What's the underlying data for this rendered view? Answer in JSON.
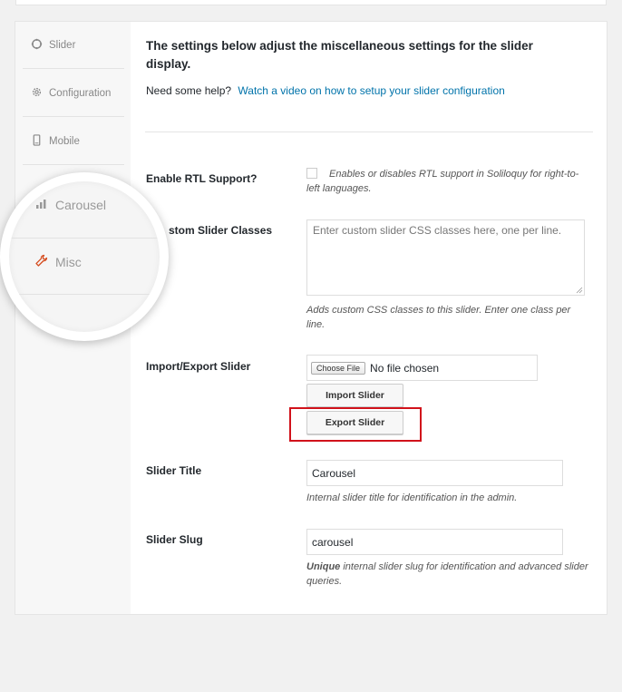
{
  "sidebar": {
    "items": [
      {
        "label": "Slider",
        "icon": "circle-icon"
      },
      {
        "label": "Configuration",
        "icon": "gear-icon"
      },
      {
        "label": "Mobile",
        "icon": "mobile-icon"
      },
      {
        "label": "Carousel",
        "icon": "chart-icon"
      },
      {
        "label": "Misc",
        "icon": "wrench-icon",
        "active": true
      }
    ]
  },
  "main": {
    "intro_title": "The settings below adjust the miscellaneous settings for the slider display.",
    "help_prefix": "Need some help?",
    "help_link": "Watch a video on how to setup your slider configuration",
    "rtl": {
      "label": "Enable RTL Support?",
      "checked": false,
      "description": "Enables or disables RTL support in Soliloquy for right-to-left languages."
    },
    "classes": {
      "label": "Custom Slider Classes",
      "label_visible": "stom Slider Classes",
      "placeholder": "Enter custom slider CSS classes here, one per line.",
      "description": "Adds custom CSS classes to this slider. Enter one class per line."
    },
    "import_export": {
      "label": "Import/Export Slider",
      "choose_file": "Choose File",
      "file_status": "No file chosen",
      "import_button": "Import Slider",
      "export_button": "Export Slider"
    },
    "title": {
      "label": "Slider Title",
      "value": "Carousel",
      "description": "Internal slider title for identification in the admin."
    },
    "slug": {
      "label": "Slider Slug",
      "value": "carousel",
      "description_bold": "Unique",
      "description_rest": " internal slider slug for identification and advanced slider queries."
    }
  },
  "colors": {
    "accent_link": "#0073aa",
    "highlight": "#d1121b",
    "active_tab": "#d54e21"
  }
}
